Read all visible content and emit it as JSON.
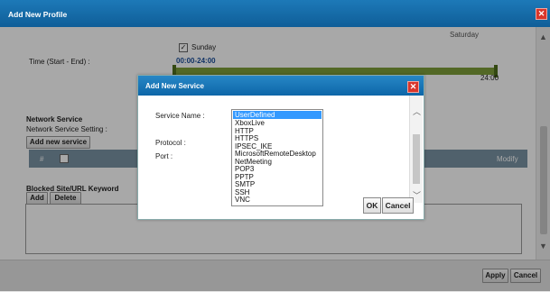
{
  "window": {
    "title": "Add New Profile"
  },
  "schedule": {
    "day_label": "Saturday",
    "sunday_label": "Sunday",
    "time_label": "Time (Start - End) :",
    "time_value": "00:00-24:00",
    "end_label": "24:00"
  },
  "network_service": {
    "heading": "Network Service",
    "setting_label": "Network Service Setting :",
    "add_button": "Add new service",
    "grid_headers": {
      "index": "#",
      "modify": "Modify"
    }
  },
  "blocked": {
    "heading": "Blocked Site/URL Keyword",
    "add_button": "Add",
    "delete_button": "Delete"
  },
  "footer": {
    "apply": "Apply",
    "cancel": "Cancel"
  },
  "modal": {
    "title": "Add New Service",
    "service_name_label": "Service Name :",
    "protocol_label": "Protocol :",
    "port_label": "Port :",
    "options": [
      "UserDefined",
      "XboxLive",
      "HTTP",
      "HTTPS",
      "IPSEC_IKE",
      "MicrosoftRemoteDesktop",
      "NetMeeting",
      "POP3",
      "PPTP",
      "SMTP",
      "SSH",
      "VNC"
    ],
    "selected": "UserDefined",
    "ok": "OK",
    "cancel": "Cancel"
  },
  "colors": {
    "title_blue": "#1d79b8",
    "close_red": "#d9362b",
    "time_bar": "#7e9f3b",
    "selection": "#3399ff"
  }
}
